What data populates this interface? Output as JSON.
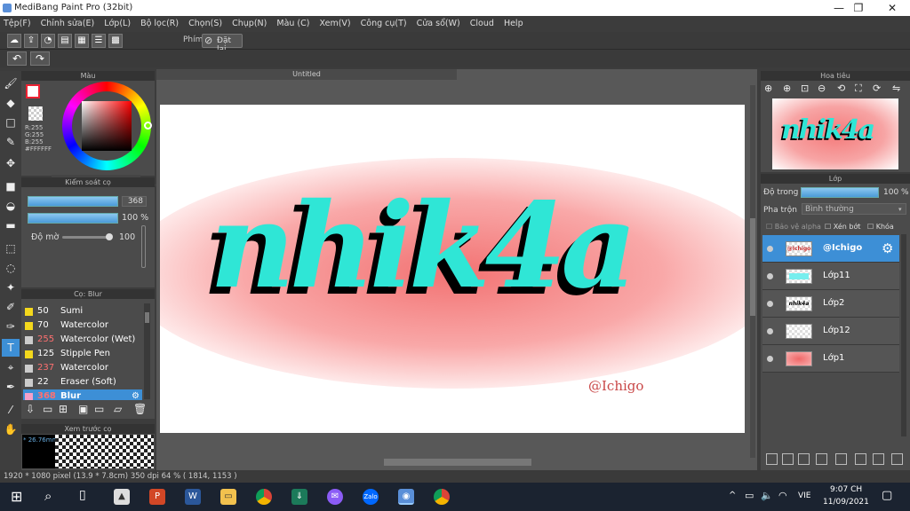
{
  "window": {
    "title": "MediBang Paint Pro (32bit)",
    "minimize": "—",
    "maximize": "❐",
    "close": "✕"
  },
  "menu": [
    "Tệp(F)",
    "Chỉnh sửa(E)",
    "Lớp(L)",
    "Bộ lọc(R)",
    "Chọn(S)",
    "Chụp(N)",
    "Màu (C)",
    "Xem(V)",
    "Công cụ(T)",
    "Cửa sổ(W)",
    "Cloud",
    "Help"
  ],
  "toolbar": {
    "shortcut_label": "Phím",
    "reset_label": "Đặt lại"
  },
  "canvas": {
    "tab_title": "Untitled",
    "artwork_text": "nhik4a",
    "signature": "@Ichigo"
  },
  "color_panel": {
    "title": "Màu",
    "r": "R:255",
    "g": "G:255",
    "b": "B:255",
    "hex": "#FFFFFF"
  },
  "brush_control": {
    "title": "Kiểm soát cọ",
    "size_value": "368",
    "opacity_value": "100 %",
    "blur_label": "Độ mờ",
    "blur_value": "100"
  },
  "brush_panel": {
    "title": "Cọ: Blur",
    "items": [
      {
        "size": "50",
        "name": "Sumi",
        "color": "#f4d81c",
        "size_color": "#ffffff"
      },
      {
        "size": "70",
        "name": "Watercolor",
        "color": "#f4d81c",
        "size_color": "#ffffff"
      },
      {
        "size": "255",
        "name": "Watercolor (Wet)",
        "color": "#cccccc",
        "size_color": "#ff7070"
      },
      {
        "size": "125",
        "name": "Stipple Pen",
        "color": "#f4d81c",
        "size_color": "#ffffff"
      },
      {
        "size": "237",
        "name": "Watercolor",
        "color": "#cccccc",
        "size_color": "#ff7070"
      },
      {
        "size": "22",
        "name": "Eraser (Soft)",
        "color": "#cccccc",
        "size_color": "#ffffff"
      },
      {
        "size": "368",
        "name": "Blur",
        "color": "#f4a0c8",
        "size_color": "#ff7070"
      }
    ]
  },
  "brush_preview": {
    "title": "Xem trước cọ",
    "value": "* 26.76mm"
  },
  "navigator": {
    "title": "Hoa tiêu"
  },
  "layers": {
    "title": "Lớp",
    "opacity_label": "Độ trong",
    "opacity_value": "100 %",
    "blend_label": "Pha trộn",
    "blend_value": "Bình thường",
    "protect_alpha": "Bảo vệ alpha",
    "clipping": "Xén bớt",
    "lock": "Khóa",
    "items": [
      {
        "name": "@Ichigo",
        "thumb": "@Ichigo"
      },
      {
        "name": "Lớp11",
        "thumb": ""
      },
      {
        "name": "Lớp2",
        "thumb": "nhik4a"
      },
      {
        "name": "Lớp12",
        "thumb": ""
      },
      {
        "name": "Lớp1",
        "thumb": ""
      }
    ]
  },
  "statusbar": {
    "text": "1920 * 1080 pixel  (13.9 * 7.8cm)  350 dpi  64 %  ( 1814, 1153 )"
  },
  "taskbar": {
    "lang": "VIE",
    "time": "9:07 CH",
    "date": "11/09/2021",
    "zalo": "Zalo",
    "up": "^"
  },
  "colors": {
    "accent": "#3d8fd6",
    "aqua": "#2fe6d6",
    "blur_red": "#f06868"
  }
}
